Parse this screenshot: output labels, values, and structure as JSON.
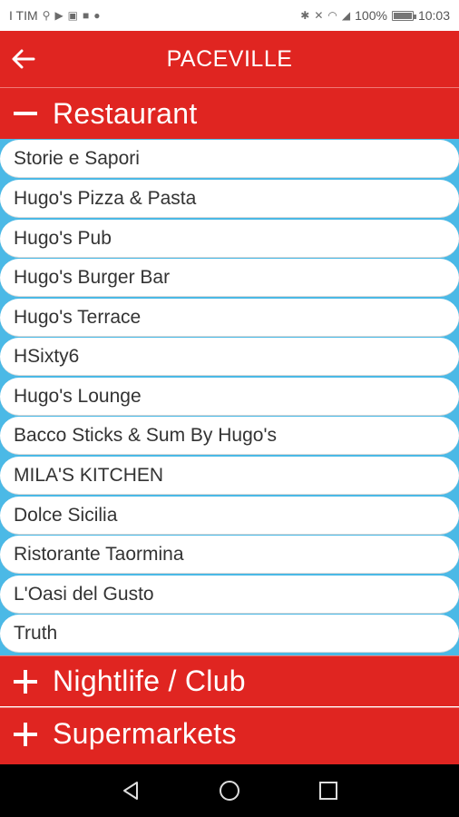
{
  "status_bar": {
    "carrier": "I TIM",
    "battery": "100%",
    "battery_level": 1.0,
    "time": "10:03"
  },
  "app_bar": {
    "title": "PACEVILLE",
    "back_icon": "arrow-left-icon"
  },
  "sections": [
    {
      "title": "Restaurant",
      "expanded": true,
      "sign_icon": "minus-icon",
      "items": [
        "Storie e Sapori",
        "Hugo's Pizza & Pasta",
        "Hugo's Pub",
        "Hugo's Burger Bar",
        "Hugo's Terrace",
        "HSixty6",
        "Hugo's Lounge",
        "Bacco Sticks & Sum By Hugo's",
        "MILA'S KITCHEN",
        "Dolce Sicilia",
        "Ristorante Taormina",
        "L'Oasi del Gusto",
        "Truth"
      ]
    },
    {
      "title": "Nightlife / Club",
      "expanded": false,
      "sign_icon": "plus-icon"
    },
    {
      "title": "Supermarkets",
      "expanded": false,
      "sign_icon": "plus-icon"
    }
  ],
  "nav_bar": {
    "back": "triangle-back-icon",
    "home": "circle-home-icon",
    "recents": "square-recents-icon"
  },
  "colors": {
    "accent": "#e02521",
    "list_background": "#4bb9e6",
    "nav_background": "#000000"
  }
}
